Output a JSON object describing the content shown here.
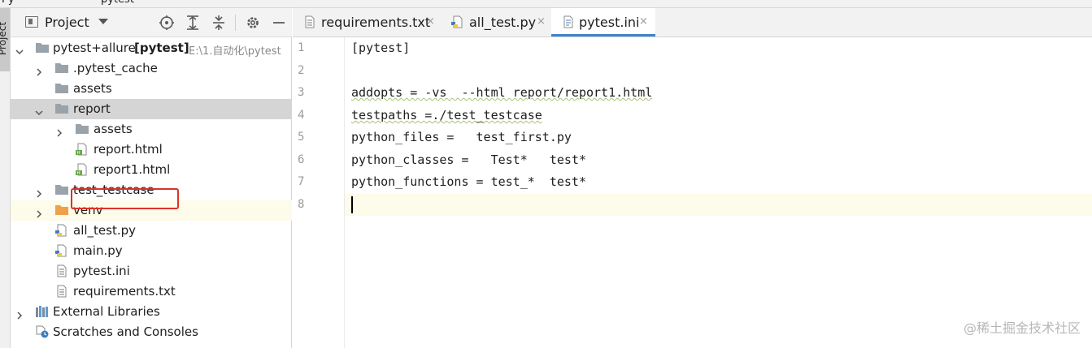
{
  "top_fragments": [
    "Py",
    "—",
    "pytest"
  ],
  "side_tab_label": "Project",
  "project_panel": {
    "title": "Project",
    "toolbar_icons": [
      "locate-icon",
      "expand-all-icon",
      "collapse-all-icon",
      "gear-icon",
      "minimize-icon"
    ]
  },
  "tree": [
    {
      "name": "pytest+allure",
      "bold_suffix": "[pytest]",
      "path": "E:\\1.自动化\\pytest",
      "icon": "folder-icon",
      "expanded": true
    },
    {
      "name": ".pytest_cache",
      "icon": "folder-icon",
      "expanded": false
    },
    {
      "name": "assets",
      "icon": "folder-icon"
    },
    {
      "name": "report",
      "icon": "folder-icon",
      "expanded": true,
      "selected": true
    },
    {
      "name": "assets",
      "icon": "folder-icon",
      "expanded": false
    },
    {
      "name": "report.html",
      "icon": "html-file-icon"
    },
    {
      "name": "report1.html",
      "icon": "html-file-icon",
      "highlighted_box": true
    },
    {
      "name": "test_testcase",
      "icon": "folder-icon",
      "expanded": false
    },
    {
      "name": "venv",
      "icon": "orange-folder-icon",
      "expanded": false
    },
    {
      "name": "all_test.py",
      "icon": "python-file-icon"
    },
    {
      "name": "main.py",
      "icon": "python-file-icon"
    },
    {
      "name": "pytest.ini",
      "icon": "text-file-icon"
    },
    {
      "name": "requirements.txt",
      "icon": "text-file-icon"
    },
    {
      "name": "External Libraries",
      "icon": "libraries-icon",
      "expanded": false
    },
    {
      "name": "Scratches and Consoles",
      "icon": "scratches-icon"
    }
  ],
  "tabs": [
    {
      "label": "requirements.txt",
      "icon": "text-file-icon",
      "close": "×"
    },
    {
      "label": "all_test.py",
      "icon": "python-file-icon",
      "close": "×"
    },
    {
      "label": "pytest.ini",
      "icon": "ini-file-icon",
      "close": "×",
      "active": true
    }
  ],
  "editor": {
    "lines": [
      "[pytest]",
      "",
      "addopts = -vs  --html report/report1.html",
      "testpaths =./test_testcase",
      "python_files =   test_first.py",
      "python_classes =   Test*   test*",
      "python_functions = test_*  test*",
      ""
    ],
    "line_numbers": [
      "1",
      "2",
      "3",
      "4",
      "5",
      "6",
      "7",
      "8"
    ],
    "current_line": 8
  },
  "watermark": "@稀土掘金技术社区",
  "colors": {
    "selection": "#d5d5d5",
    "current_line": "#fdfbe9",
    "active_tab_underline": "#4083c9",
    "highlight_box": "#d9342b"
  }
}
